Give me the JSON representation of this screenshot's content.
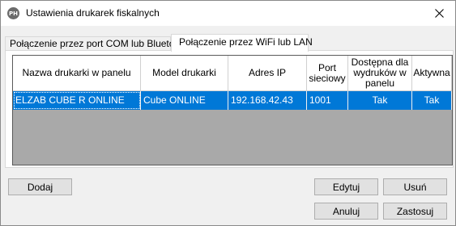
{
  "window": {
    "title": "Ustawienia drukarek fiskalnych",
    "app_icon_text": "PH",
    "close_icon": "close-icon"
  },
  "tabs": [
    {
      "label": "Połączenie przez port COM lub Bluetooth",
      "selected": false
    },
    {
      "label": "Połączenie przez WiFi lub LAN",
      "selected": true
    }
  ],
  "grid": {
    "columns": [
      "Nazwa drukarki w panelu",
      "Model drukarki",
      "Adres IP",
      "Port sieciowy",
      "Dostępna dla wydruków w panelu",
      "Aktywna"
    ],
    "rows": [
      {
        "name": "ELZAB CUBE R ONLINE",
        "model": "Cube ONLINE",
        "ip": "192.168.42.43",
        "port": "1001",
        "available": "Tak",
        "active": "Tak",
        "selected": true
      }
    ],
    "selection_color": "#0078d7",
    "empty_area_color": "#a9a9a9"
  },
  "buttons": {
    "add": "Dodaj",
    "edit": "Edytuj",
    "delete": "Usuń",
    "cancel": "Anuluj",
    "apply": "Zastosuj"
  }
}
